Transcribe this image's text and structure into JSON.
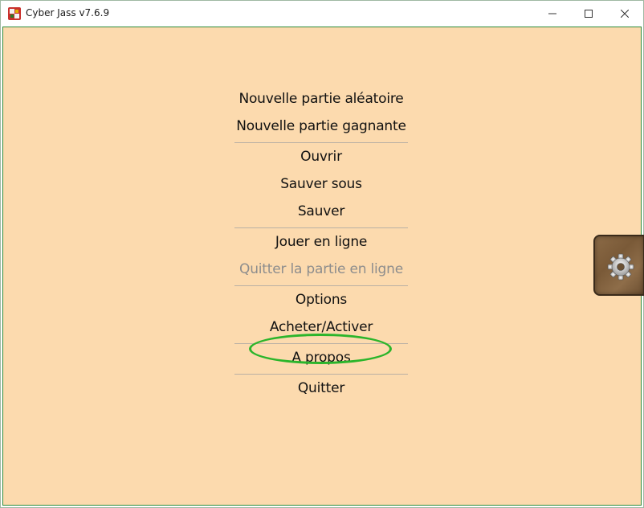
{
  "window": {
    "title": "Cyber Jass v7.6.9",
    "controls": [
      "minimize",
      "maximize",
      "close"
    ]
  },
  "menu": {
    "items": [
      {
        "label": "Nouvelle partie aléatoire",
        "enabled": true
      },
      {
        "label": "Nouvelle partie gagnante",
        "enabled": true
      },
      {
        "label": "Ouvrir",
        "enabled": true
      },
      {
        "label": "Sauver sous",
        "enabled": true
      },
      {
        "label": "Sauver",
        "enabled": true
      },
      {
        "label": "Jouer en ligne",
        "enabled": true
      },
      {
        "label": "Quitter la partie en ligne",
        "enabled": false
      },
      {
        "label": "Options",
        "enabled": true
      },
      {
        "label": "Acheter/Activer",
        "enabled": true,
        "highlighted": true
      },
      {
        "label": "A propos",
        "enabled": true
      },
      {
        "label": "Quitter",
        "enabled": true
      }
    ]
  },
  "side_button": {
    "icon": "gear-icon"
  },
  "colors": {
    "background": "#fcdaae",
    "highlight": "#2bb52b",
    "disabled_text": "#8d8d8d",
    "panel_wood": "#7a5a38"
  }
}
